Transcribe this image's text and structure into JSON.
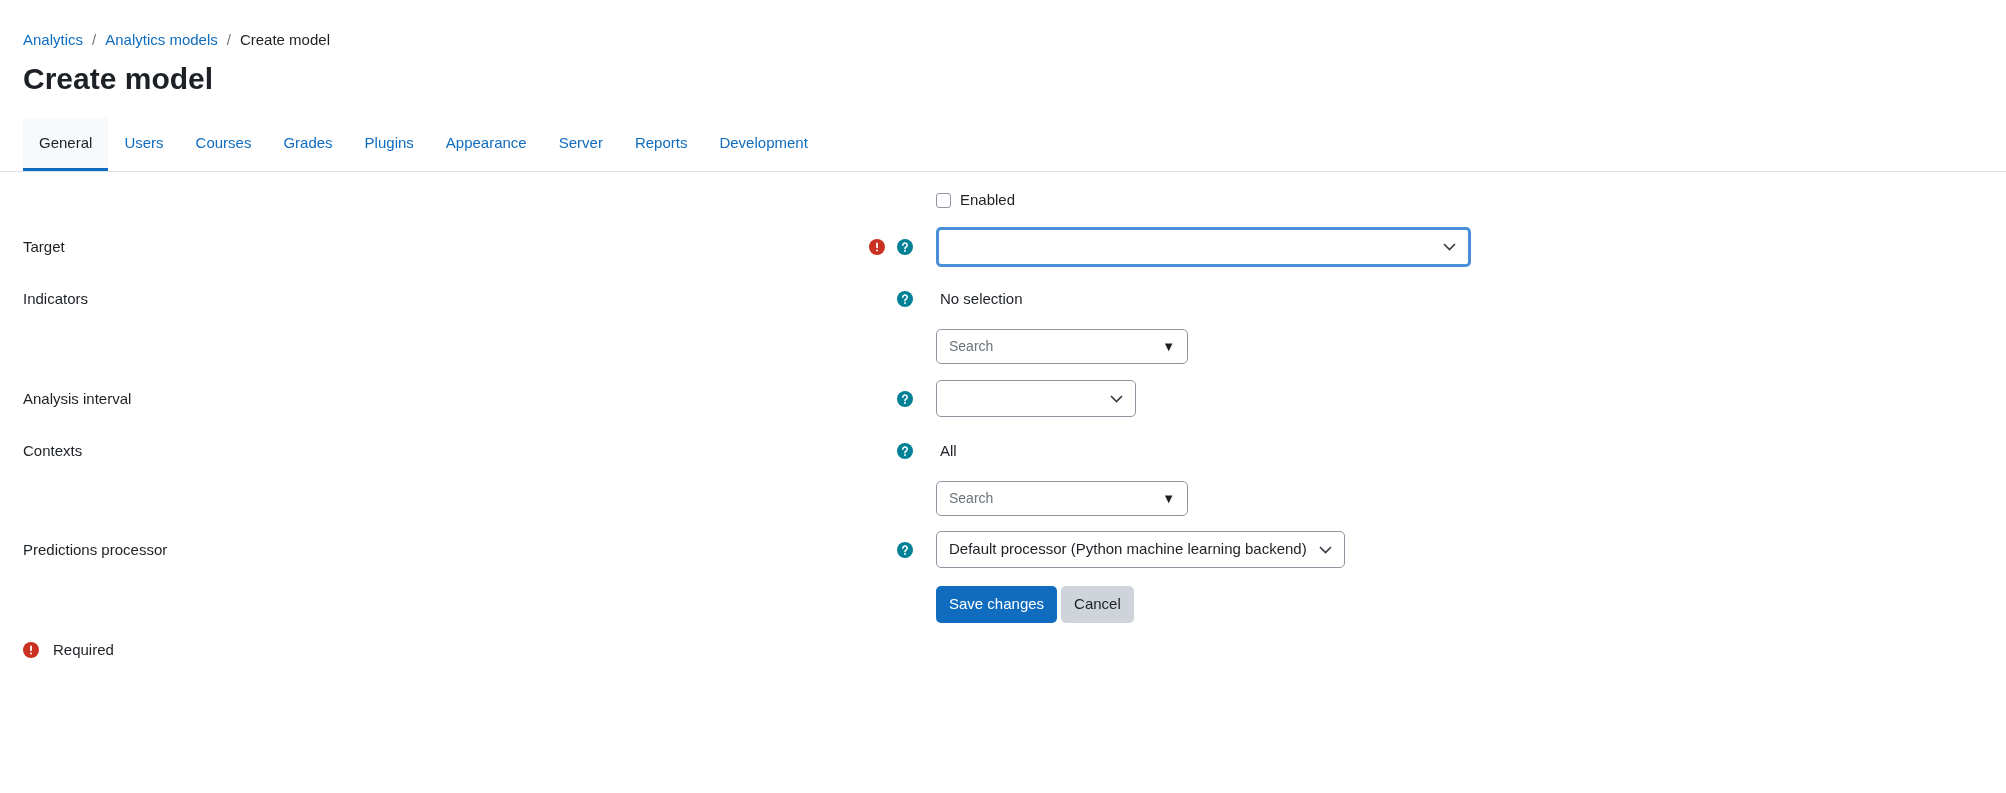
{
  "breadcrumb": [
    {
      "kind": "link",
      "label": "Analytics"
    },
    {
      "kind": "separator",
      "label": "/"
    },
    {
      "kind": "link",
      "label": "Analytics models"
    },
    {
      "kind": "separator",
      "label": "/"
    },
    {
      "kind": "current",
      "label": "Create model"
    }
  ],
  "title": "Create model",
  "tabs": [
    {
      "label": "General",
      "selected": true
    },
    {
      "label": "Users",
      "selected": false
    },
    {
      "label": "Courses",
      "selected": false
    },
    {
      "label": "Grades",
      "selected": false
    },
    {
      "label": "Plugins",
      "selected": false
    },
    {
      "label": "Appearance",
      "selected": false
    },
    {
      "label": "Server",
      "selected": false
    },
    {
      "label": "Reports",
      "selected": false
    },
    {
      "label": "Development",
      "selected": false
    }
  ],
  "form": {
    "fields": [
      {
        "kind": "checkbox",
        "label": "Enabled",
        "checked": false
      },
      {
        "kind": "select",
        "label": "Target",
        "required": true,
        "help": true,
        "focused": true
      },
      {
        "kind": "autocomplete",
        "label": "Indicators",
        "required": false,
        "help": true,
        "selection": "No selection",
        "placeholder": "Search",
        "arrow": "▼"
      },
      {
        "kind": "select",
        "label": "Analysis interval",
        "required": false,
        "help": true,
        "focused": false
      },
      {
        "kind": "autocomplete",
        "label": "Contexts",
        "required": false,
        "help": true,
        "selection": "All",
        "placeholder": "Search",
        "arrow": "▼"
      },
      {
        "kind": "select",
        "label": "Predictions processor",
        "required": false,
        "help": true,
        "focused": false,
        "value": "Default processor (Python machine learning backend)"
      }
    ],
    "buttons": [
      {
        "label": "Save changes",
        "primary": true
      },
      {
        "label": "Cancel",
        "primary": false
      }
    ],
    "required_note": "Required"
  }
}
